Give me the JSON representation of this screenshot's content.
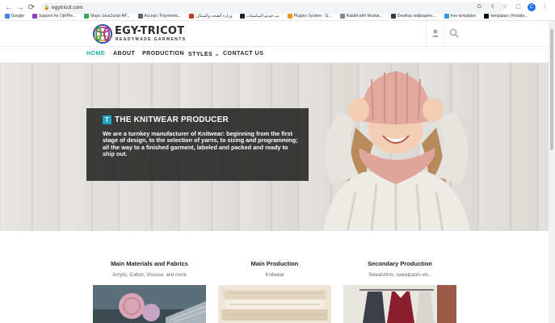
{
  "browser": {
    "url": "egytricot.com",
    "profile_initial": "C",
    "bookmarks": [
      {
        "label": "Google",
        "color": "#4285f4"
      },
      {
        "label": "Support for DjinPle...",
        "color": "#8e44ad"
      },
      {
        "label": "Maps JavaScript AP...",
        "color": "#34a853"
      },
      {
        "label": "Accept | Payments...",
        "color": "#5f6368"
      },
      {
        "label": "وزارة الصحة والسكان",
        "color": "#c0392b"
      },
      {
        "label": "بث فيديو التماسيات",
        "color": "#222222"
      },
      {
        "label": "Plugins System - G...",
        "color": "#f39c12"
      },
      {
        "label": "Rabbit with Mustar...",
        "color": "#7f8c8d"
      },
      {
        "label": "Desktop wallpapers...",
        "color": "#2c3e50"
      },
      {
        "label": "free templates",
        "color": "#3498db"
      },
      {
        "label": "templates | Portafo...",
        "color": "#111111"
      }
    ]
  },
  "site": {
    "logo_text": "EGY-TRICOT",
    "logo_sub": "READYMADE GARMENTS",
    "nav": [
      {
        "label": "HOME",
        "active": true
      },
      {
        "label": "ABOUT",
        "active": false
      },
      {
        "label": "PRODUCTION",
        "active": false
      },
      {
        "label": "STYLES ⌄",
        "active": false
      },
      {
        "label": "CONTACT US",
        "active": false
      }
    ]
  },
  "hero": {
    "icon_letter": "T",
    "title": "THE KNITWEAR PRODUCER",
    "body": "We are a turnkey manufacturer of Knitwear: beginning from the first stage of design, to the selection of yarns, to sizing and programming; all the way to a finished garment, labeled and packed and ready to ship out."
  },
  "sections": [
    {
      "title": "Main Materials and Fabrics",
      "subtitle": "Acrylic, Cotton, Viscose, and more"
    },
    {
      "title": "Main Production",
      "subtitle": "Knitwear"
    },
    {
      "title": "Secondary Production",
      "subtitle": "Sweatshirts, sweatpants etc.."
    }
  ],
  "icons": {
    "back": "arrow-left-icon",
    "forward": "arrow-right-icon",
    "reload": "reload-icon",
    "lock": "lock-icon",
    "user": "user-icon",
    "search": "search-icon"
  },
  "colors": {
    "accent": "#1ab0b0",
    "hero_box": "#222222",
    "t_badge": "#1aa3c2"
  }
}
